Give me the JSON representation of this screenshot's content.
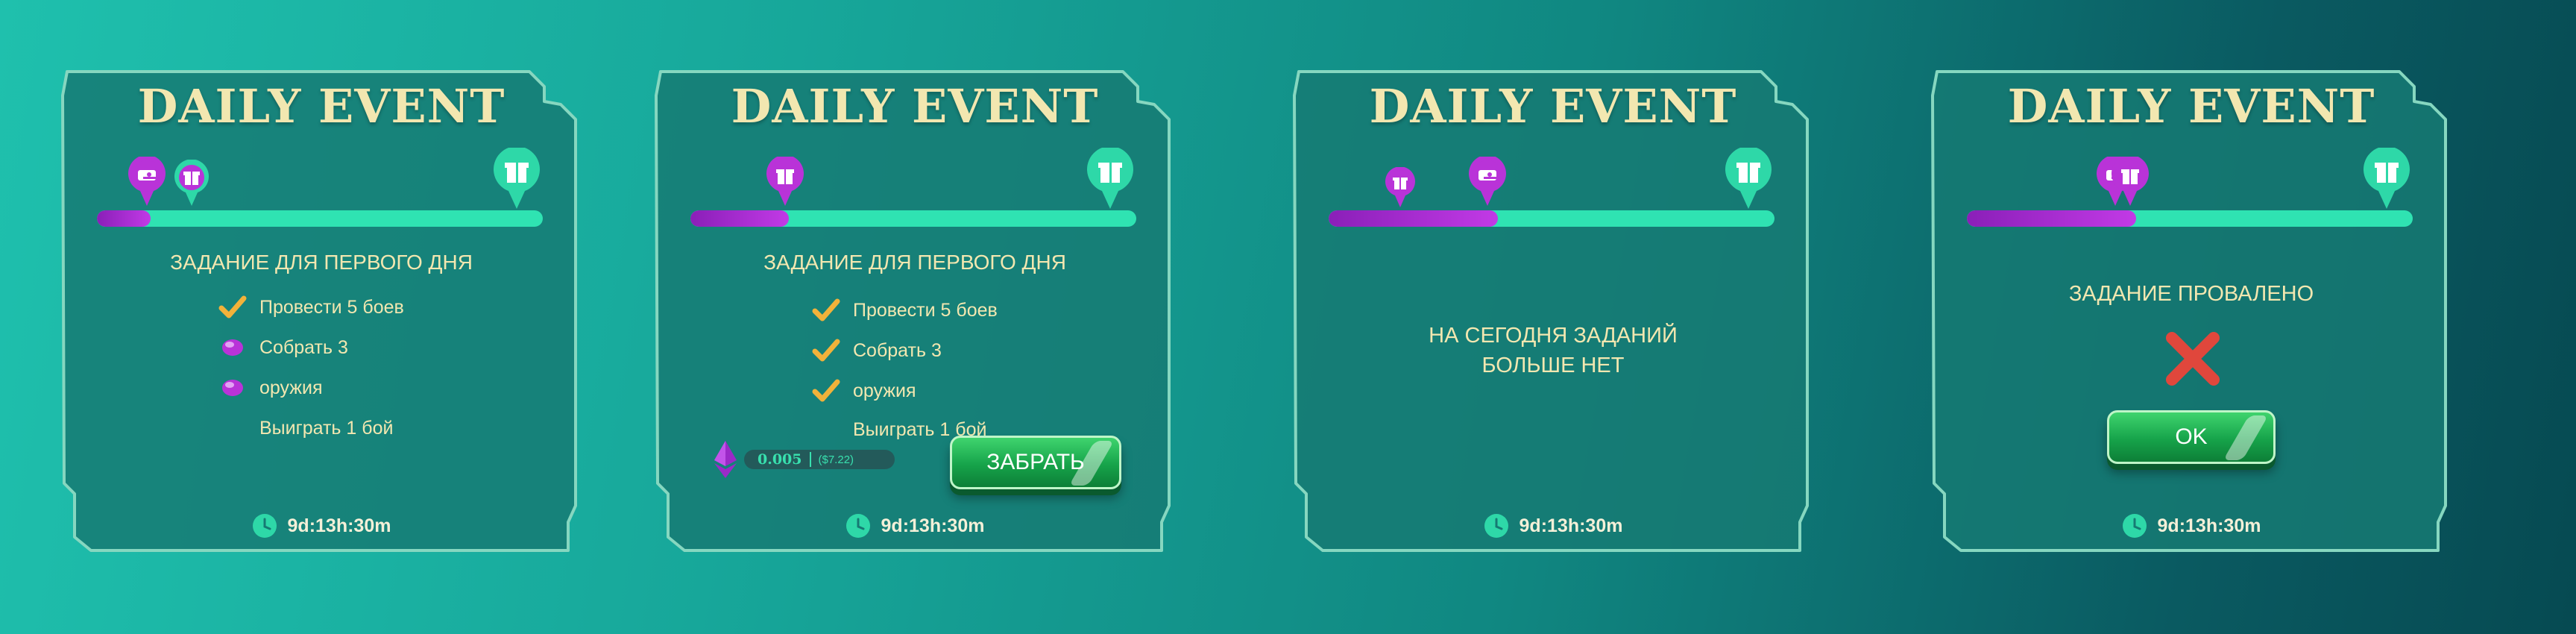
{
  "panels": [
    {
      "title": "DAILY EVENT",
      "progress": 0.12,
      "task_title": "ЗАДАНИЕ ДЛЯ ПЕРВОГО ДНЯ",
      "tasks": [
        {
          "label": "Провести 5 боев",
          "state": "done"
        },
        {
          "label": "Собрать 3",
          "state": "pending"
        },
        {
          "label": "оружия",
          "state": "pending"
        },
        {
          "label": "Выиграть 1 бой",
          "state": "none"
        }
      ],
      "timer": "9d:13h:30m"
    },
    {
      "title": "DAILY EVENT",
      "progress": 0.22,
      "task_title": "ЗАДАНИЕ ДЛЯ ПЕРВОГО ДНЯ",
      "tasks": [
        {
          "label": "Провести 5 боев",
          "state": "done"
        },
        {
          "label": "Собрать 3",
          "state": "done"
        },
        {
          "label": "оружия",
          "state": "done"
        },
        {
          "label": "Выиграть 1 бой",
          "state": "none"
        }
      ],
      "reward_amount": "0.005",
      "reward_usd": "($7.22)",
      "claim_label": "ЗАБРАТЬ",
      "timer": "9d:13h:30m"
    },
    {
      "title": "DAILY EVENT",
      "progress": 0.38,
      "message": [
        "НА СЕГОДНЯ ЗАДАНИЙ",
        "БОЛЬШЕ НЕТ"
      ],
      "timer": "9d:13h:30m"
    },
    {
      "title": "DAILY EVENT",
      "progress": 0.38,
      "message": [
        "ЗАДАНИЕ ПРОВАЛЕНО"
      ],
      "ok_label": "OK",
      "timer": "9d:13h:30m"
    }
  ],
  "colors": {
    "panel_fill": "#167a73",
    "panel_border": "#86d7c0",
    "title": "#f2e7b0",
    "track": "#2fe3b2",
    "progress": "#a12fd1",
    "teal_marker": "#2ed8a8",
    "purple_marker": "#b933d8",
    "check": "#f2b23a",
    "fail": "#e0473c"
  },
  "icons": {
    "marker_gift": "gift-icon",
    "marker_monster": "monster-icon",
    "task_done": "checkmark-icon",
    "task_pending": "purple-gem-icon",
    "timer": "clock-icon",
    "currency": "ethereum-icon",
    "fail": "cross-icon"
  }
}
